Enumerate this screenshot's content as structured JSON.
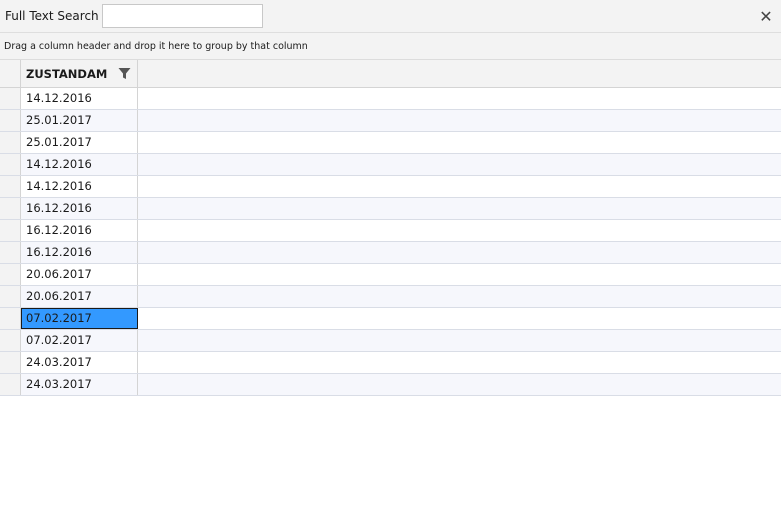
{
  "search": {
    "label": "Full Text Search",
    "value": "",
    "placeholder": "",
    "clear_label": "✕"
  },
  "group_panel": {
    "hint": "Drag a column header and drop it here to group by that column"
  },
  "grid": {
    "columns": [
      {
        "header": "ZUSTANDAM",
        "icon": "filter-icon"
      }
    ],
    "rows": [
      "14.12.2016",
      "25.01.2017",
      "25.01.2017",
      "14.12.2016",
      "14.12.2016",
      "16.12.2016",
      "16.12.2016",
      "16.12.2016",
      "20.06.2017",
      "20.06.2017",
      "07.02.2017",
      "07.02.2017",
      "24.03.2017",
      "24.03.2017"
    ],
    "selected_row_index": 10
  },
  "colors": {
    "selection": "#3399ff",
    "alt_row": "#f6f7fc",
    "panel": "#f3f3f3"
  }
}
